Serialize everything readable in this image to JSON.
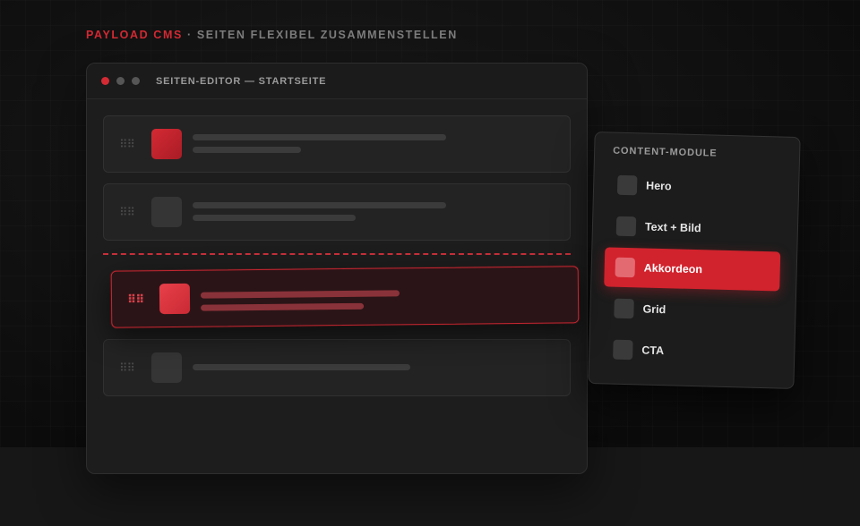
{
  "tagline": {
    "brand": "PAYLOAD CMS",
    "separator": "·",
    "text": "SEITEN FLEXIBEL ZUSAMMENSTELLEN"
  },
  "editor": {
    "title": "SEITEN-EDITOR — STARTSEITE",
    "handle_glyph": "⠿⠿",
    "blocks": [
      {
        "thumb": "red-square"
      },
      {
        "thumb": "gray-square"
      },
      {
        "thumb": "gray-square"
      }
    ],
    "dragged_block": {
      "thumb": "red-square"
    }
  },
  "module_panel": {
    "title": "CONTENT-MODULE",
    "items": [
      {
        "label": "Hero",
        "active": false
      },
      {
        "label": "Text + Bild",
        "active": false
      },
      {
        "label": "Akkordeon",
        "active": true
      },
      {
        "label": "Grid",
        "active": false
      },
      {
        "label": "CTA",
        "active": false
      }
    ]
  },
  "colors": {
    "accent": "#d1232d",
    "background": "#111111",
    "card": "#1d1d1d"
  }
}
